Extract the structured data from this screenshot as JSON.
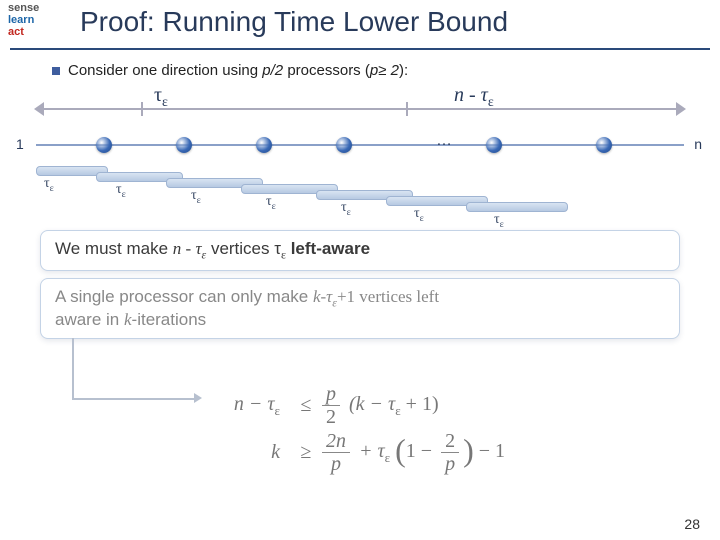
{
  "logo": {
    "l1": "sense",
    "l2": "learn",
    "l3": "act"
  },
  "title": "Proof: Running Time Lower Bound",
  "bullet": {
    "pre": "Consider one direction using ",
    "frac": "p/2",
    "mid": " processors (",
    "cond": "p≥ 2",
    "post": "):"
  },
  "tau": "τ",
  "eps": "ε",
  "axis": {
    "left_label": "τ",
    "right_label_pre": "n - τ",
    "node_1": "1",
    "node_n": "n",
    "dots": "…"
  },
  "box1": {
    "pre": "We must make ",
    "expr": "n - τ",
    "mid": " vertices τ",
    "post": " left-aware"
  },
  "box2": {
    "line1_pre": "A single processor can only make  ",
    "line1_expr": "k-τ",
    "line1_post": "+1 vertices left",
    "line2": "aware in ",
    "line2_it": "k",
    "line2_post": "-iterations"
  },
  "ineq": {
    "lhs1_a": "n − τ",
    "op": "≤",
    "rhs1_num": "p",
    "rhs1_den": "2",
    "rhs1_tail": "(k − τ",
    "rhs1_tail2": " + 1)",
    "lhs2": "k",
    "op2": "≥",
    "rhs2_a_num": "2n",
    "rhs2_a_den": "p",
    "rhs2_plus": " + τ",
    "rhs2_par_num": "1 − ",
    "rhs2_par_frac_num": "2",
    "rhs2_par_frac_den": "p",
    "rhs2_tail": " − 1"
  },
  "page": "28"
}
